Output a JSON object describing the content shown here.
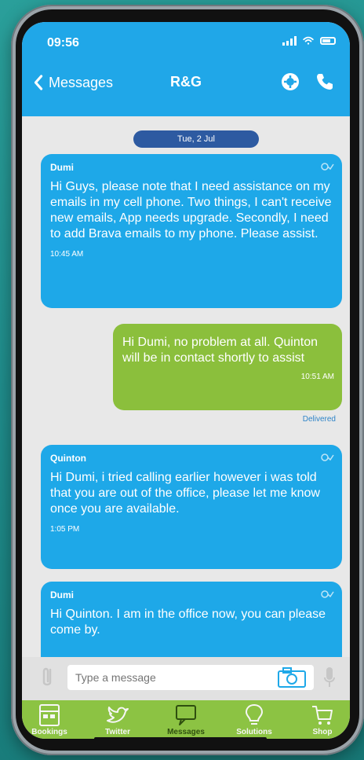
{
  "status_bar": {
    "time": "09:56",
    "icons": [
      "signal-icon",
      "wifi-icon",
      "battery-icon"
    ]
  },
  "header": {
    "back_label": "Messages",
    "title": "R&G",
    "icons": [
      "settings-icon",
      "phone-icon"
    ]
  },
  "chat": {
    "date": "Tue, 2 Jul",
    "messages": [
      {
        "direction": "incoming",
        "sender": "Dumi",
        "text": "Hi Guys, please note that I need assistance on my emails in my cell phone. Two things, I can't receive new emails, App needs upgrade. Secondly, I need to add Brava emails to my phone. Please assist.",
        "time": "10:45 AM"
      },
      {
        "direction": "outgoing",
        "text": "Hi Dumi, no problem at all. Quinton will be in contact shortly to assist",
        "time": "10:51 AM",
        "status": "Delivered"
      },
      {
        "direction": "incoming",
        "sender": "Quinton",
        "text": "Hi Dumi, i tried calling earlier however i was told that you are out of the office, please let me know once you are available.",
        "time": "1:05 PM"
      },
      {
        "direction": "incoming",
        "sender": "Dumi",
        "text": "Hi Quinton. I am in the office now, you can please come by."
      }
    ]
  },
  "composer": {
    "placeholder": "Type a message",
    "icons": [
      "attachment-icon",
      "camera-icon",
      "microphone-icon"
    ]
  },
  "tabbar": {
    "tabs": [
      {
        "label": "Bookings",
        "icon": "bookings-icon"
      },
      {
        "label": "Twitter",
        "icon": "twitter-icon"
      },
      {
        "label": "Messages",
        "icon": "messages-icon"
      },
      {
        "label": "Solutions",
        "icon": "solutions-icon"
      },
      {
        "label": "Shop",
        "icon": "shop-icon"
      }
    ],
    "active_tab": "Messages"
  },
  "colors": {
    "header_blue": "#20a7e8",
    "incoming_bubble": "#1ea8e8",
    "outgoing_bubble": "#8bbf3c",
    "tabbar_green": "#8cc343",
    "date_pill": "#2d5aa1"
  }
}
